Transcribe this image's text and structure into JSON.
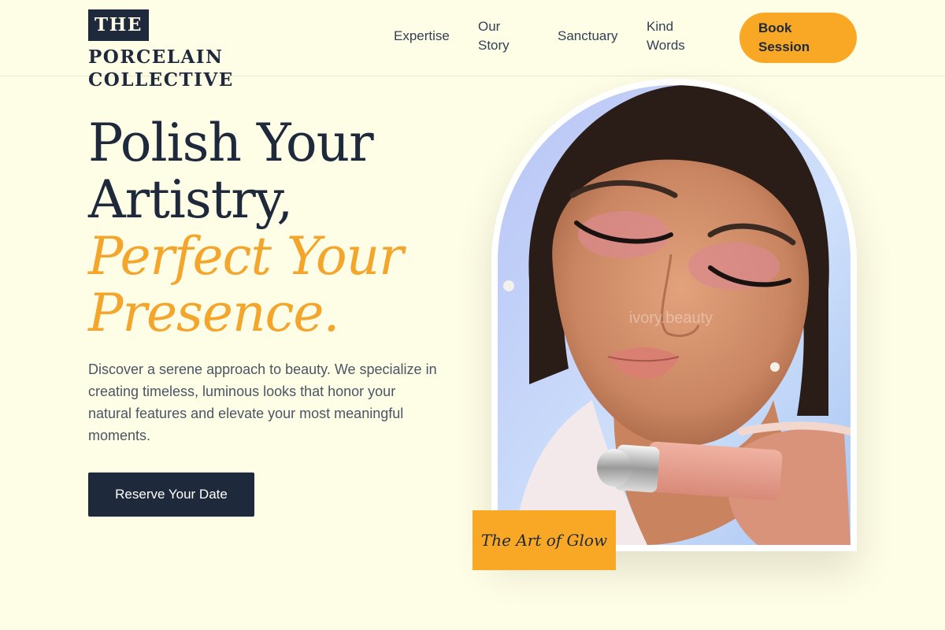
{
  "brand": {
    "logo_the": "THE",
    "logo_rest": "PORCELAIN",
    "logo_line2": "COLLECTIVE"
  },
  "nav": {
    "items": [
      {
        "label": "Expertise"
      },
      {
        "label": "Our Story"
      },
      {
        "label": "Sanctuary"
      },
      {
        "label": "Kind Words"
      }
    ],
    "book_label": "Book Session"
  },
  "hero": {
    "headline_line1": "Polish Your",
    "headline_line2": "Artistry,",
    "headline_accent1": "Perfect Your",
    "headline_accent2": "Presence.",
    "description": "Discover a serene approach to beauty. We specialize in creating timeless, luminous looks that honor your natural features and elevate your most meaningful moments.",
    "cta_label": "Reserve Your Date",
    "badge_text": "The Art of Glow",
    "image": "portrait-model-holding-serum-bottle",
    "image_watermark": "ivory.beauty"
  },
  "colors": {
    "background": "#fefde6",
    "navy": "#1e293b",
    "accent": "#f9a826",
    "accent_text": "#f3a52c"
  }
}
